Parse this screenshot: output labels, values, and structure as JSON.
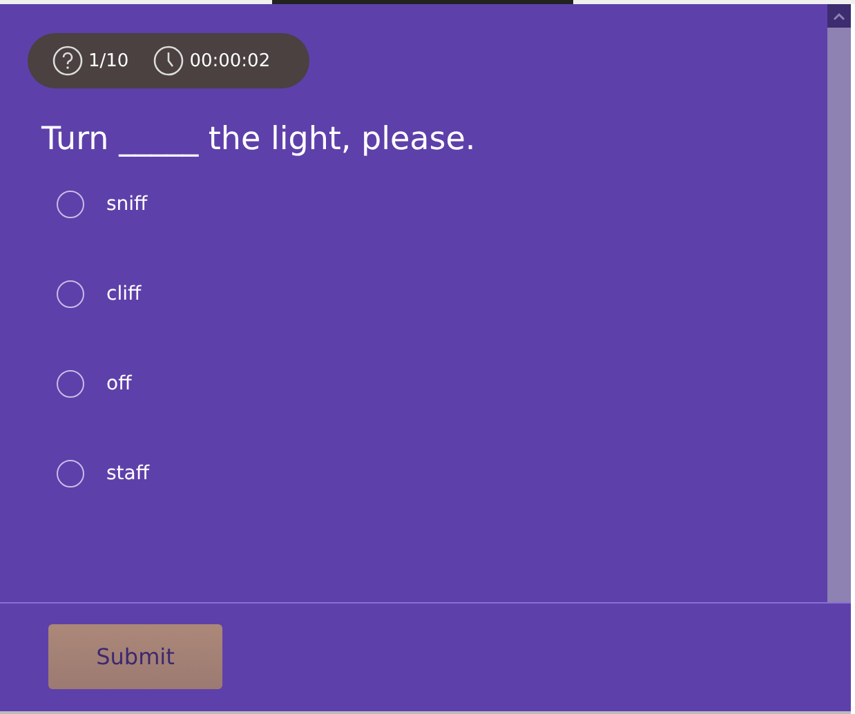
{
  "status": {
    "progress": "1/10",
    "timer": "00:00:02"
  },
  "question": "Turn _____ the light, please.",
  "options": [
    {
      "label": "sniff",
      "selected": false
    },
    {
      "label": "cliff",
      "selected": false
    },
    {
      "label": "off",
      "selected": false
    },
    {
      "label": "staff",
      "selected": false
    }
  ],
  "submit": {
    "label": "Submit"
  }
}
